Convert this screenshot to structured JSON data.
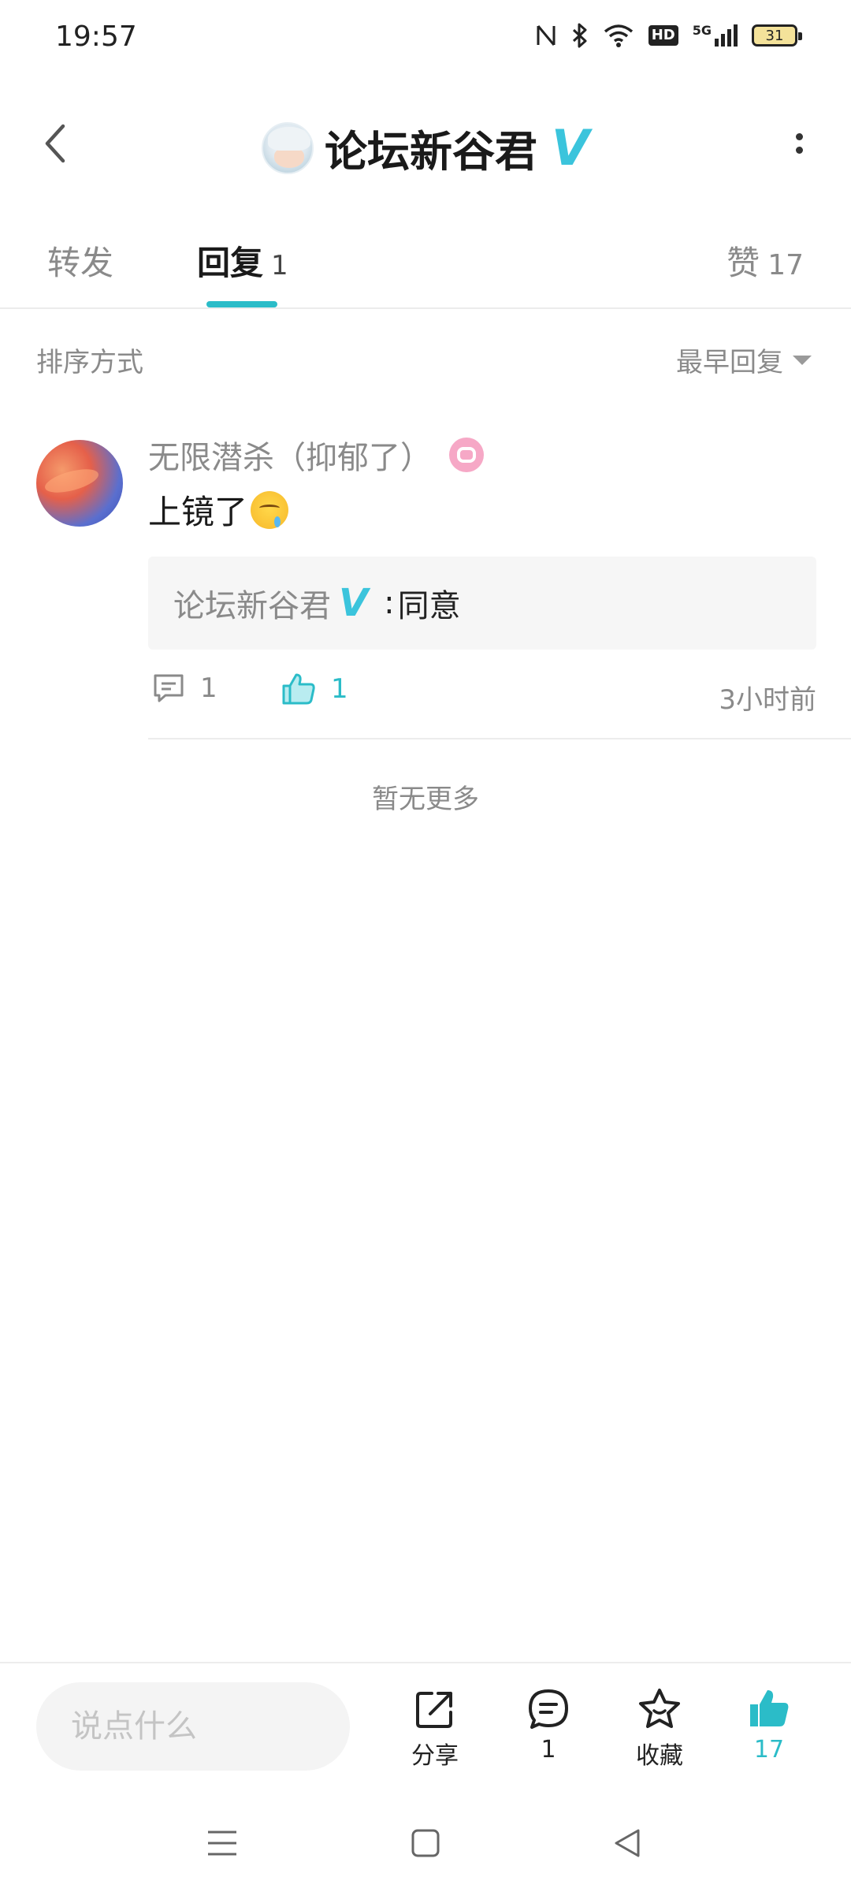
{
  "status_bar": {
    "time": "19:57",
    "hd": "HD",
    "network": "5G",
    "battery": "31"
  },
  "header": {
    "title": "论坛新谷君"
  },
  "tabs": {
    "forward": {
      "label": "转发"
    },
    "reply": {
      "label": "回复",
      "count": "1"
    },
    "like": {
      "label": "赞",
      "count": "17"
    }
  },
  "sort": {
    "label": "排序方式",
    "selected": "最早回复"
  },
  "comment": {
    "author": "无限潜杀（抑郁了）",
    "text": "上镜了",
    "sub_reply": {
      "author": "论坛新谷君",
      "separator": ":",
      "text": "同意"
    },
    "reply_count": "1",
    "like_count": "1",
    "time": "3小时前"
  },
  "no_more": "暂无更多",
  "bottom_bar": {
    "input_placeholder": "说点什么",
    "share_label": "分享",
    "comment_count": "1",
    "favorite_label": "收藏",
    "like_count": "17"
  },
  "colors": {
    "accent": "#2bbcc8",
    "verified": "#3bc4dc"
  }
}
